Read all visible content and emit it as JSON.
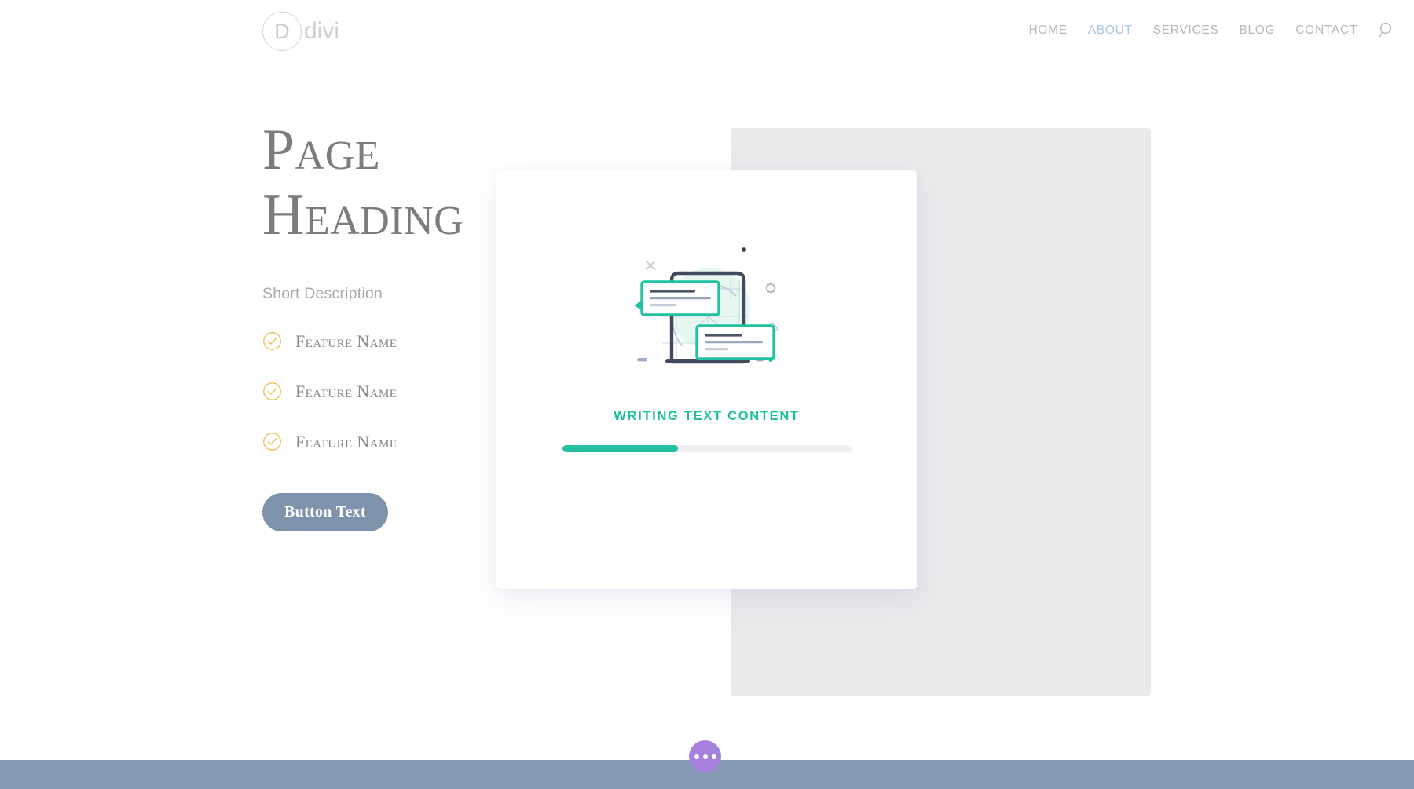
{
  "header": {
    "logo": {
      "mark": "D",
      "word": "divi",
      "icon": "divi-logo-icon"
    },
    "nav": [
      {
        "label": "HOME",
        "active": false
      },
      {
        "label": "ABOUT",
        "active": true
      },
      {
        "label": "SERVICES",
        "active": false
      },
      {
        "label": "BLOG",
        "active": false
      },
      {
        "label": "CONTACT",
        "active": false
      }
    ],
    "search_icon": "search-icon"
  },
  "hero": {
    "heading": "Page\nHeading",
    "short_description": "Short Description",
    "features": [
      {
        "label": "Feature Name",
        "icon": "circle-check-icon"
      },
      {
        "label": "Feature Name",
        "icon": "circle-check-icon"
      },
      {
        "label": "Feature Name",
        "icon": "circle-check-icon"
      }
    ],
    "button_label": "Button Text"
  },
  "card": {
    "illustration_name": "writing-text-content-illustration",
    "title": "WRITING TEXT CONTENT",
    "progress_percent": 40
  },
  "fab": {
    "icon": "ellipsis-icon",
    "label": ""
  },
  "colors": {
    "accent_teal": "#26bfa0",
    "nav_active_blue": "#a8c5e3",
    "button_slate": "#7e92ac",
    "footer_slate": "#8499b3",
    "fab_purple": "#a580dd",
    "check_gold": "#e8c25f",
    "heading_gray": "#7b7c80",
    "panel_gray": "#eaeaec"
  }
}
